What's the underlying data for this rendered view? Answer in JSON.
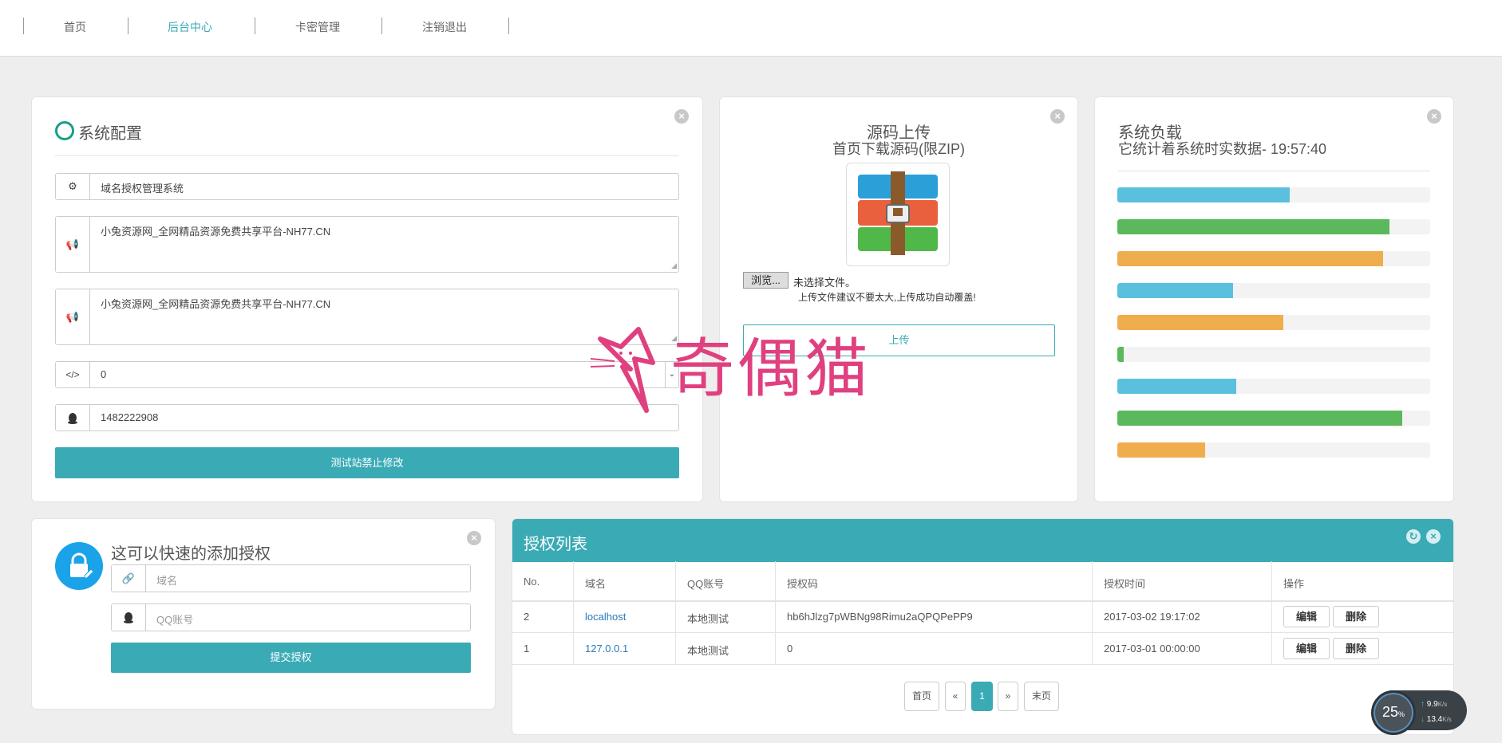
{
  "nav": {
    "items": [
      {
        "label": "首页",
        "active": false
      },
      {
        "label": "后台中心",
        "active": true
      },
      {
        "label": "卡密管理",
        "active": false
      },
      {
        "label": "注销退出",
        "active": false
      }
    ]
  },
  "config_panel": {
    "title": "系统配置",
    "site_name": "域名授权管理系统",
    "keywords": "小兔资源网_全网精品资源免费共享平台-NH77.CN",
    "description": "小兔资源网_全网精品资源免费共享平台-NH77.CN",
    "select_value": "0",
    "qq": "1482222908",
    "submit_label": "测试站禁止修改",
    "icons": {
      "site_name": "gear-icon",
      "keywords": "megaphone-icon",
      "description": "megaphone-icon",
      "select": "code-icon",
      "qq": "qq-penguin-icon"
    }
  },
  "upload_panel": {
    "title": "源码上传",
    "subtitle": "首页下载源码(限ZIP)",
    "browse_label": "浏览...",
    "no_file_text": "未选择文件。",
    "hint": "上传文件建议不要太大,上传成功自动覆盖!",
    "upload_label": "上传",
    "archive_icon": "winrar-archive-icon"
  },
  "load_panel": {
    "title": "系统负载",
    "subtitle": "它统计着系统时实数据- 19:57:40",
    "bars": [
      {
        "value": 0.55,
        "color": "#5bc0de"
      },
      {
        "value": 0.87,
        "color": "#5cb85c"
      },
      {
        "value": 0.85,
        "color": "#f0ad4e"
      },
      {
        "value": 0.37,
        "color": "#5bc0de"
      },
      {
        "value": 0.53,
        "color": "#f0ad4e"
      },
      {
        "value": 0.02,
        "color": "#5cb85c"
      },
      {
        "value": 0.38,
        "color": "#5bc0de"
      },
      {
        "value": 0.91,
        "color": "#5cb85c"
      },
      {
        "value": 0.28,
        "color": "#f0ad4e"
      }
    ]
  },
  "quick_add_panel": {
    "title": "这可以快速的添加授权",
    "domain_placeholder": "域名",
    "qq_placeholder": "QQ账号",
    "submit_label": "提交授权",
    "lock_icon": "lock-edit-icon"
  },
  "auth_list": {
    "title": "授权列表",
    "columns": [
      "No.",
      "域名",
      "QQ账号",
      "授权码",
      "授权时间",
      "操作"
    ],
    "rows": [
      {
        "no": "2",
        "domain": "localhost",
        "qq": "本地测试",
        "code": "hb6hJlzg7pWBNg98Rimu2aQPQPePP9",
        "time": "2017-03-02 19:17:02",
        "edit": "编辑",
        "delete": "删除"
      },
      {
        "no": "1",
        "domain": "127.0.0.1",
        "qq": "本地测试",
        "code": "0",
        "time": "2017-03-01 00:00:00",
        "edit": "编辑",
        "delete": "删除"
      }
    ],
    "pagination": {
      "first": "首页",
      "prev": "«",
      "current": "1",
      "next": "»",
      "last": "末页"
    }
  },
  "watermark": {
    "text": "奇偶猫"
  },
  "speed_widget": {
    "percent": "25",
    "percent_unit": "%",
    "up": "9.9",
    "up_unit": "K/s",
    "down": "13.4",
    "down_unit": "K/s"
  },
  "colors": {
    "accent": "#3aabb5",
    "info": "#5bc0de",
    "success": "#5cb85c",
    "warning": "#f0ad4e",
    "watermark": "#e0407f"
  }
}
